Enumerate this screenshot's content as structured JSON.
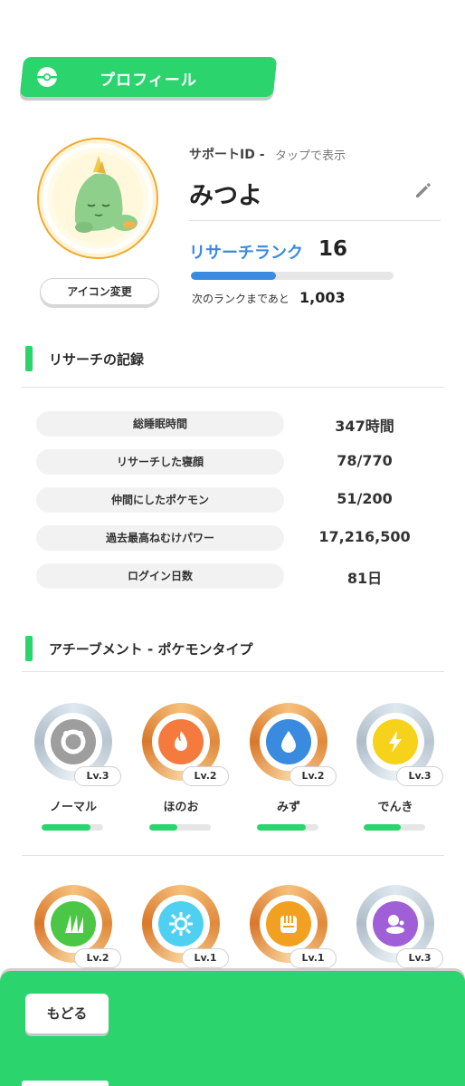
{
  "header": {
    "title": "プロフィール",
    "icon": "pokeball-icon"
  },
  "profile": {
    "support_label": "サポートID -",
    "support_hint": "タップで表示",
    "name": "みつよ",
    "icon_change_label": "アイコン変更",
    "rank_label": "リサーチランク",
    "rank_value": "16",
    "rank_progress": 0.42,
    "next_label": "次のランクまであと",
    "next_value": "1,003"
  },
  "records": {
    "title": "リサーチの記録",
    "rows": [
      {
        "label": "総睡眠時間",
        "value": "347時間"
      },
      {
        "label": "リサーチした寝顔",
        "value": "78/770"
      },
      {
        "label": "仲間にしたポケモン",
        "value": "51/200"
      },
      {
        "label": "過去最高ねむけパワー",
        "value": "17,216,500"
      },
      {
        "label": "ログイン日数",
        "value": "81日"
      }
    ]
  },
  "achievements": {
    "title": "アチーブメント - ポケモンタイプ",
    "items": [
      {
        "name": "ノーマル",
        "level": "Lv.3",
        "progress": 0.8,
        "icon": "normal-type-icon",
        "color": "#9e9e9e",
        "ring": "silver"
      },
      {
        "name": "ほのお",
        "level": "Lv.2",
        "progress": 0.45,
        "icon": "fire-type-icon",
        "color": "#f57a3d",
        "ring": "bronze"
      },
      {
        "name": "みず",
        "level": "Lv.2",
        "progress": 0.8,
        "icon": "water-type-icon",
        "color": "#3a8ae0",
        "ring": "bronze"
      },
      {
        "name": "でんき",
        "level": "Lv.3",
        "progress": 0.6,
        "icon": "electric-type-icon",
        "color": "#f7d21a",
        "ring": "silver"
      },
      {
        "name": "",
        "level": "Lv.2",
        "progress": null,
        "icon": "grass-type-icon",
        "color": "#4cc745",
        "ring": "bronze"
      },
      {
        "name": "",
        "level": "Lv.1",
        "progress": null,
        "icon": "ice-type-icon",
        "color": "#4fd0f0",
        "ring": "bronze"
      },
      {
        "name": "",
        "level": "Lv.1",
        "progress": null,
        "icon": "fighting-type-icon",
        "color": "#f2a020",
        "ring": "bronze"
      },
      {
        "name": "",
        "level": "Lv.3",
        "progress": null,
        "icon": "poison-type-icon",
        "color": "#a05fd6",
        "ring": "silver"
      }
    ]
  },
  "footer": {
    "back_label": "もどる"
  },
  "colors": {
    "accent": "#2bd46d",
    "rank": "#3a8ae0"
  }
}
